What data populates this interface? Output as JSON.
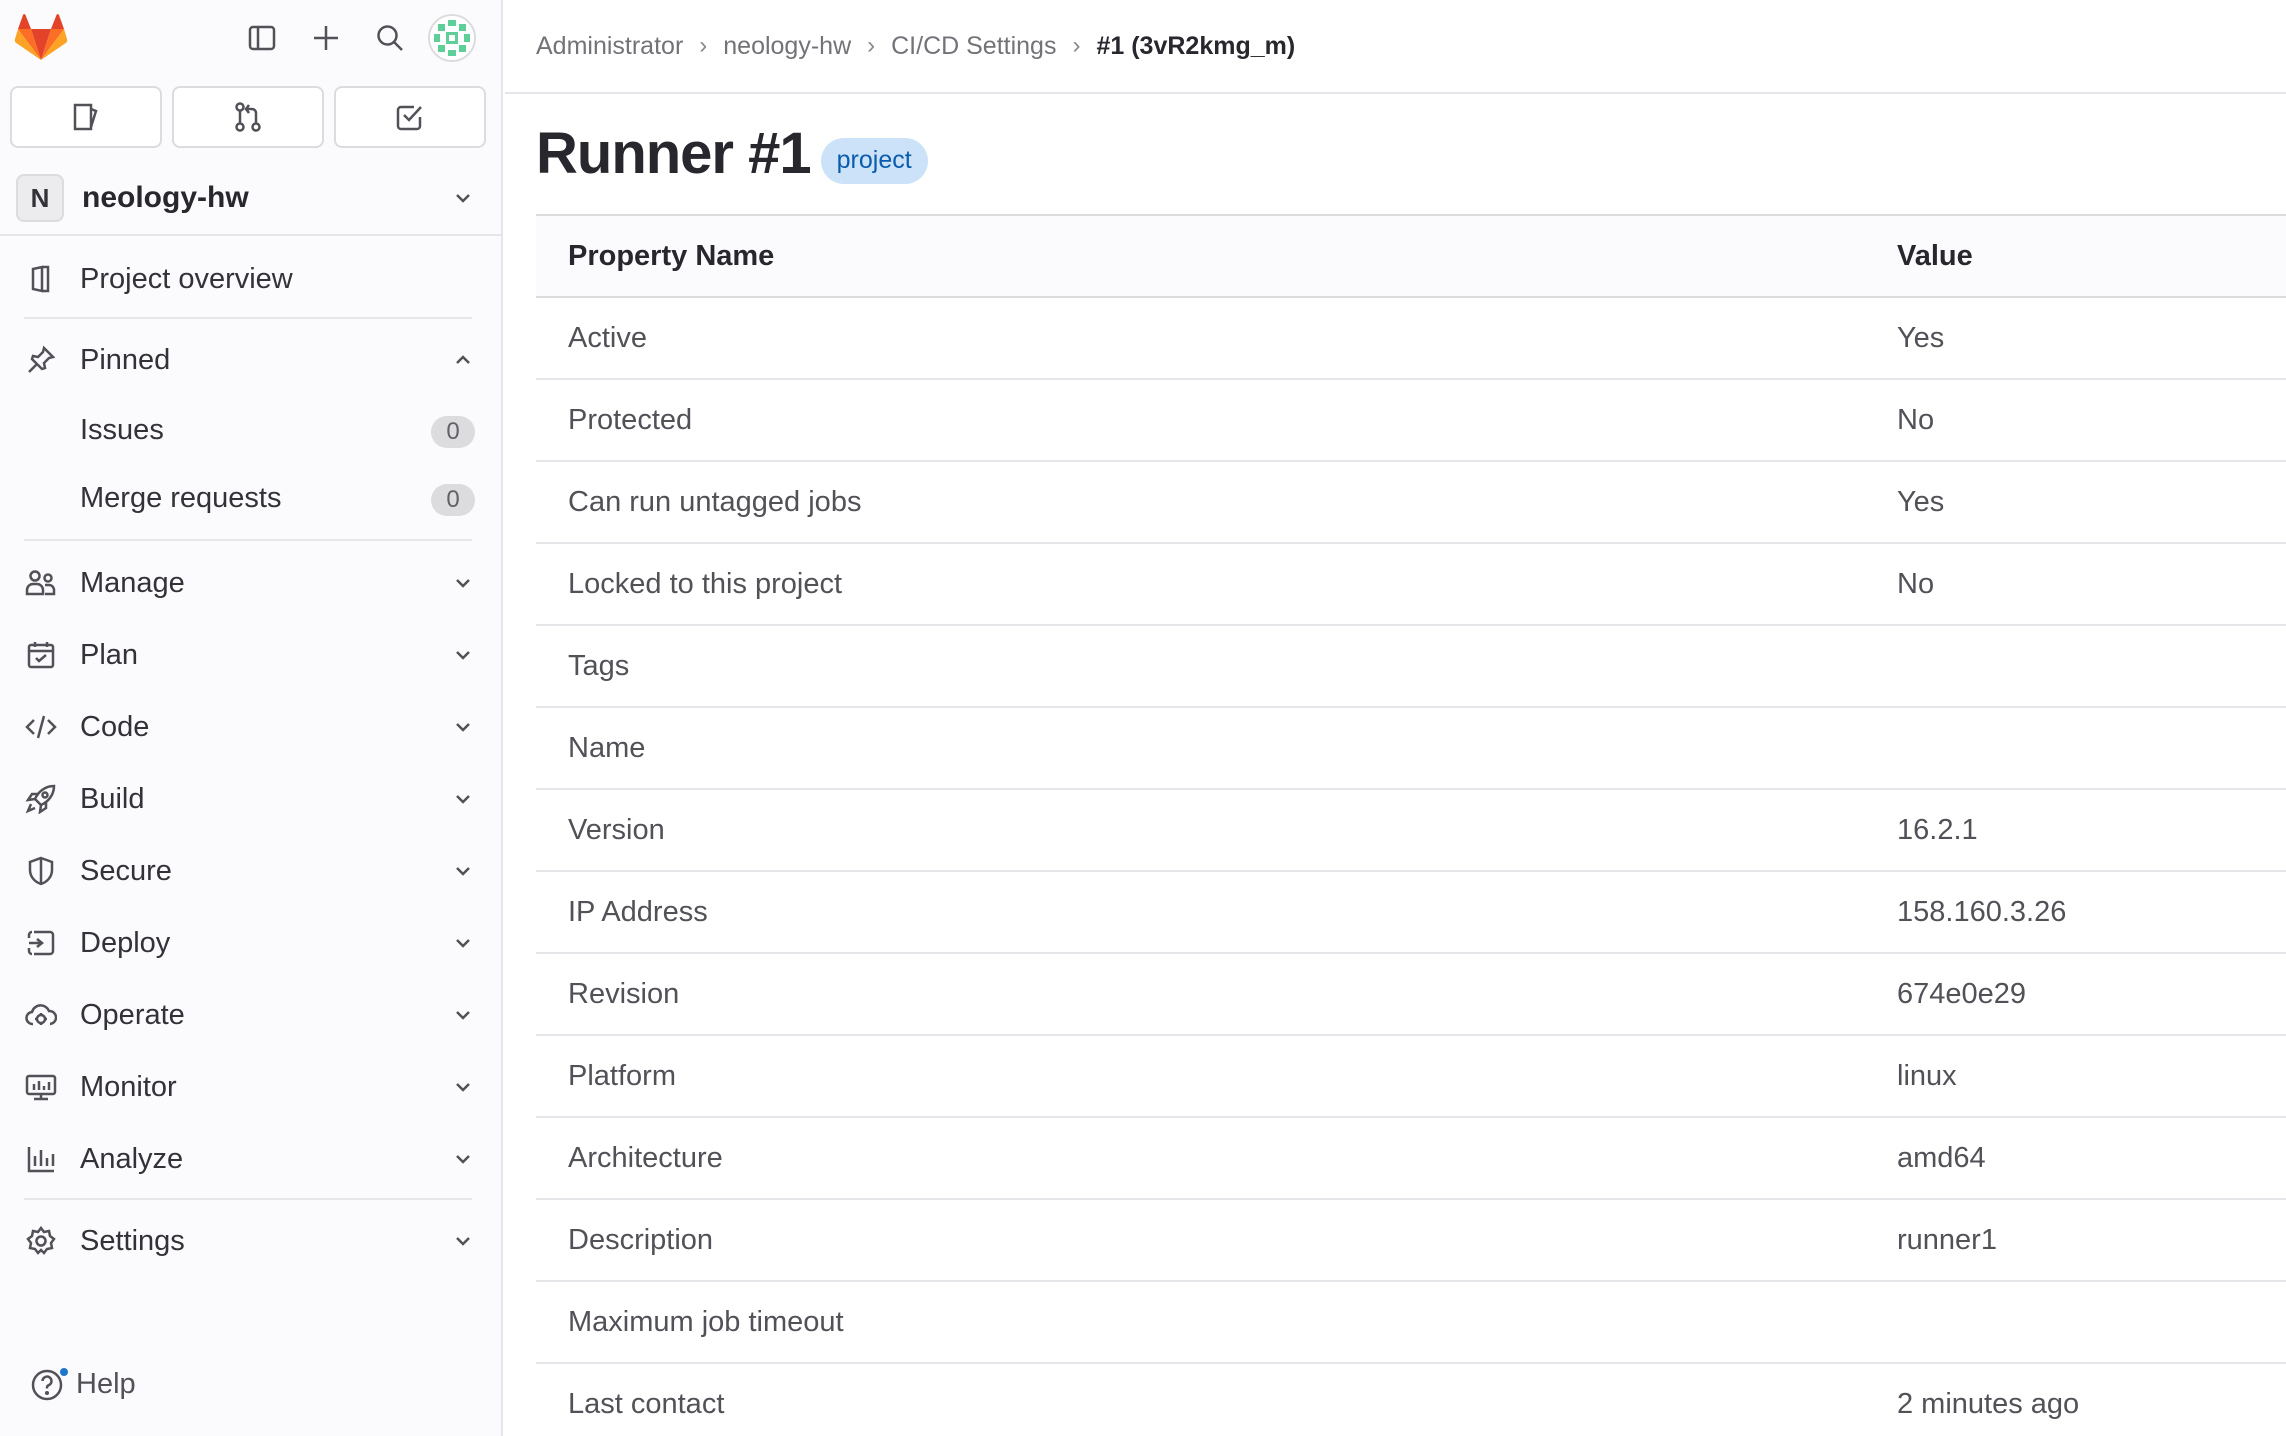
{
  "sidebar": {
    "project": {
      "initial": "N",
      "name": "neology-hw"
    },
    "project_overview": "Project overview",
    "pinned": {
      "label": "Pinned",
      "items": [
        {
          "label": "Issues",
          "count": "0"
        },
        {
          "label": "Merge requests",
          "count": "0"
        }
      ]
    },
    "sections": [
      {
        "label": "Manage",
        "icon": "users-icon"
      },
      {
        "label": "Plan",
        "icon": "calendar-icon"
      },
      {
        "label": "Code",
        "icon": "code-icon"
      },
      {
        "label": "Build",
        "icon": "rocket-icon"
      },
      {
        "label": "Secure",
        "icon": "shield-icon"
      },
      {
        "label": "Deploy",
        "icon": "deploy-icon"
      },
      {
        "label": "Operate",
        "icon": "cloud-gear-icon"
      },
      {
        "label": "Monitor",
        "icon": "monitor-icon"
      },
      {
        "label": "Analyze",
        "icon": "chart-icon"
      }
    ],
    "settings": "Settings",
    "help": "Help"
  },
  "breadcrumb": {
    "items": [
      "Administrator",
      "neology-hw",
      "CI/CD Settings"
    ],
    "current": "#1 (3vR2kmg_m)",
    "separator": "›"
  },
  "page": {
    "title": "Runner #1",
    "badge": "project"
  },
  "table": {
    "headers": [
      "Property Name",
      "Value"
    ],
    "rows": [
      [
        "Active",
        "Yes"
      ],
      [
        "Protected",
        "No"
      ],
      [
        "Can run untagged jobs",
        "Yes"
      ],
      [
        "Locked to this project",
        "No"
      ],
      [
        "Tags",
        ""
      ],
      [
        "Name",
        ""
      ],
      [
        "Version",
        "16.2.1"
      ],
      [
        "IP Address",
        "158.160.3.26"
      ],
      [
        "Revision",
        "674e0e29"
      ],
      [
        "Platform",
        "linux"
      ],
      [
        "Architecture",
        "amd64"
      ],
      [
        "Description",
        "runner1"
      ],
      [
        "Maximum job timeout",
        ""
      ],
      [
        "Last contact",
        "2 minutes ago"
      ]
    ]
  },
  "colors": {
    "brand_orange": "#e24329",
    "badge_bg": "#cbe2f9",
    "badge_text": "#0b5cad",
    "sidebar_bg": "#fbfafd"
  }
}
